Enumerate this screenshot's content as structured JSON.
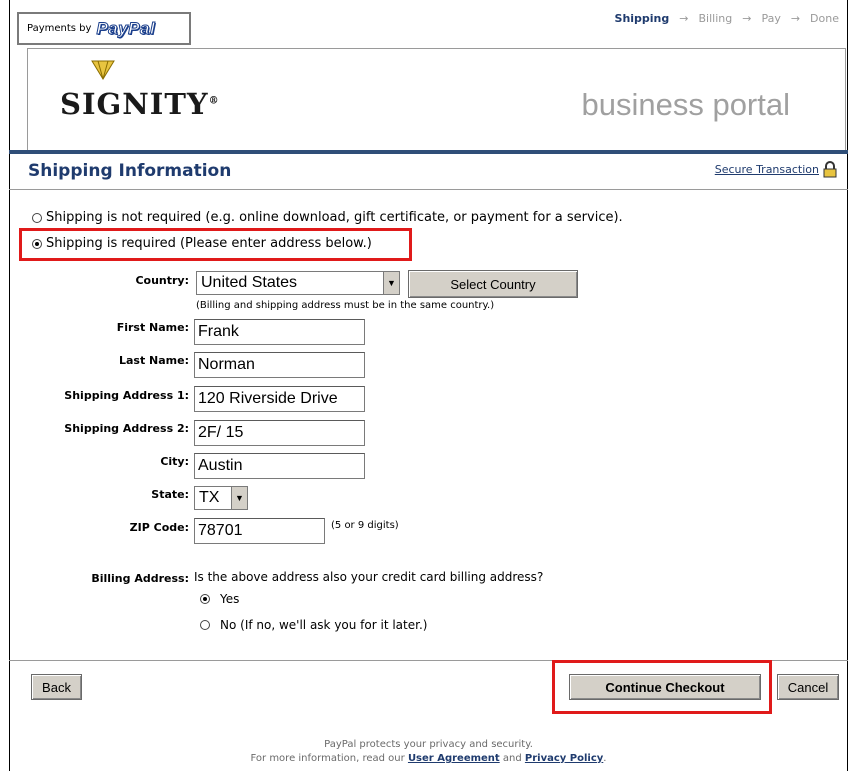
{
  "header": {
    "payments_by": "Payments by",
    "paypal": "PayPal",
    "steps": [
      "Shipping",
      "Billing",
      "Pay",
      "Done"
    ],
    "arrow": "→",
    "brand": "SIGNITY",
    "brand_reg": "®",
    "portal": "business portal"
  },
  "section": {
    "title": "Shipping Information",
    "secure_link": "Secure Transaction"
  },
  "shipping_options": {
    "not_required": "Shipping is not required (e.g. online download, gift certificate, or payment for a service).",
    "required": "Shipping is required (Please enter address below.)",
    "selected": "required"
  },
  "form": {
    "country_label": "Country:",
    "country_value": "United States",
    "select_country_button": "Select Country",
    "country_note": "(Billing and shipping address must be in the same country.)",
    "first_name_label": "First Name:",
    "first_name_value": "Frank",
    "last_name_label": "Last Name:",
    "last_name_value": "Norman",
    "address1_label": "Shipping Address 1:",
    "address1_value": "120 Riverside Drive",
    "address2_label": "Shipping Address 2:",
    "address2_value": "2F/ 15",
    "city_label": "City:",
    "city_value": "Austin",
    "state_label": "State:",
    "state_value": "TX",
    "zip_label": "ZIP Code:",
    "zip_value": "78701",
    "zip_note": "(5 or 9 digits)",
    "billing_label": "Billing Address:",
    "billing_question": "Is the above address also your credit card billing address?",
    "billing_yes": "Yes",
    "billing_no": "No (If no, we'll ask you for it later.)",
    "billing_selected": "yes"
  },
  "actions": {
    "back": "Back",
    "continue": "Continue Checkout",
    "cancel": "Cancel"
  },
  "footer": {
    "line1": "PayPal protects your privacy and security.",
    "line2_prefix": "For more information, read our",
    "user_agreement": "User Agreement",
    "and": "and",
    "privacy_policy": "Privacy Policy",
    "period": "."
  },
  "colors": {
    "highlight": "#e01a1a",
    "title_blue": "#1f3b6e",
    "rule_blue": "#2f4e78"
  }
}
